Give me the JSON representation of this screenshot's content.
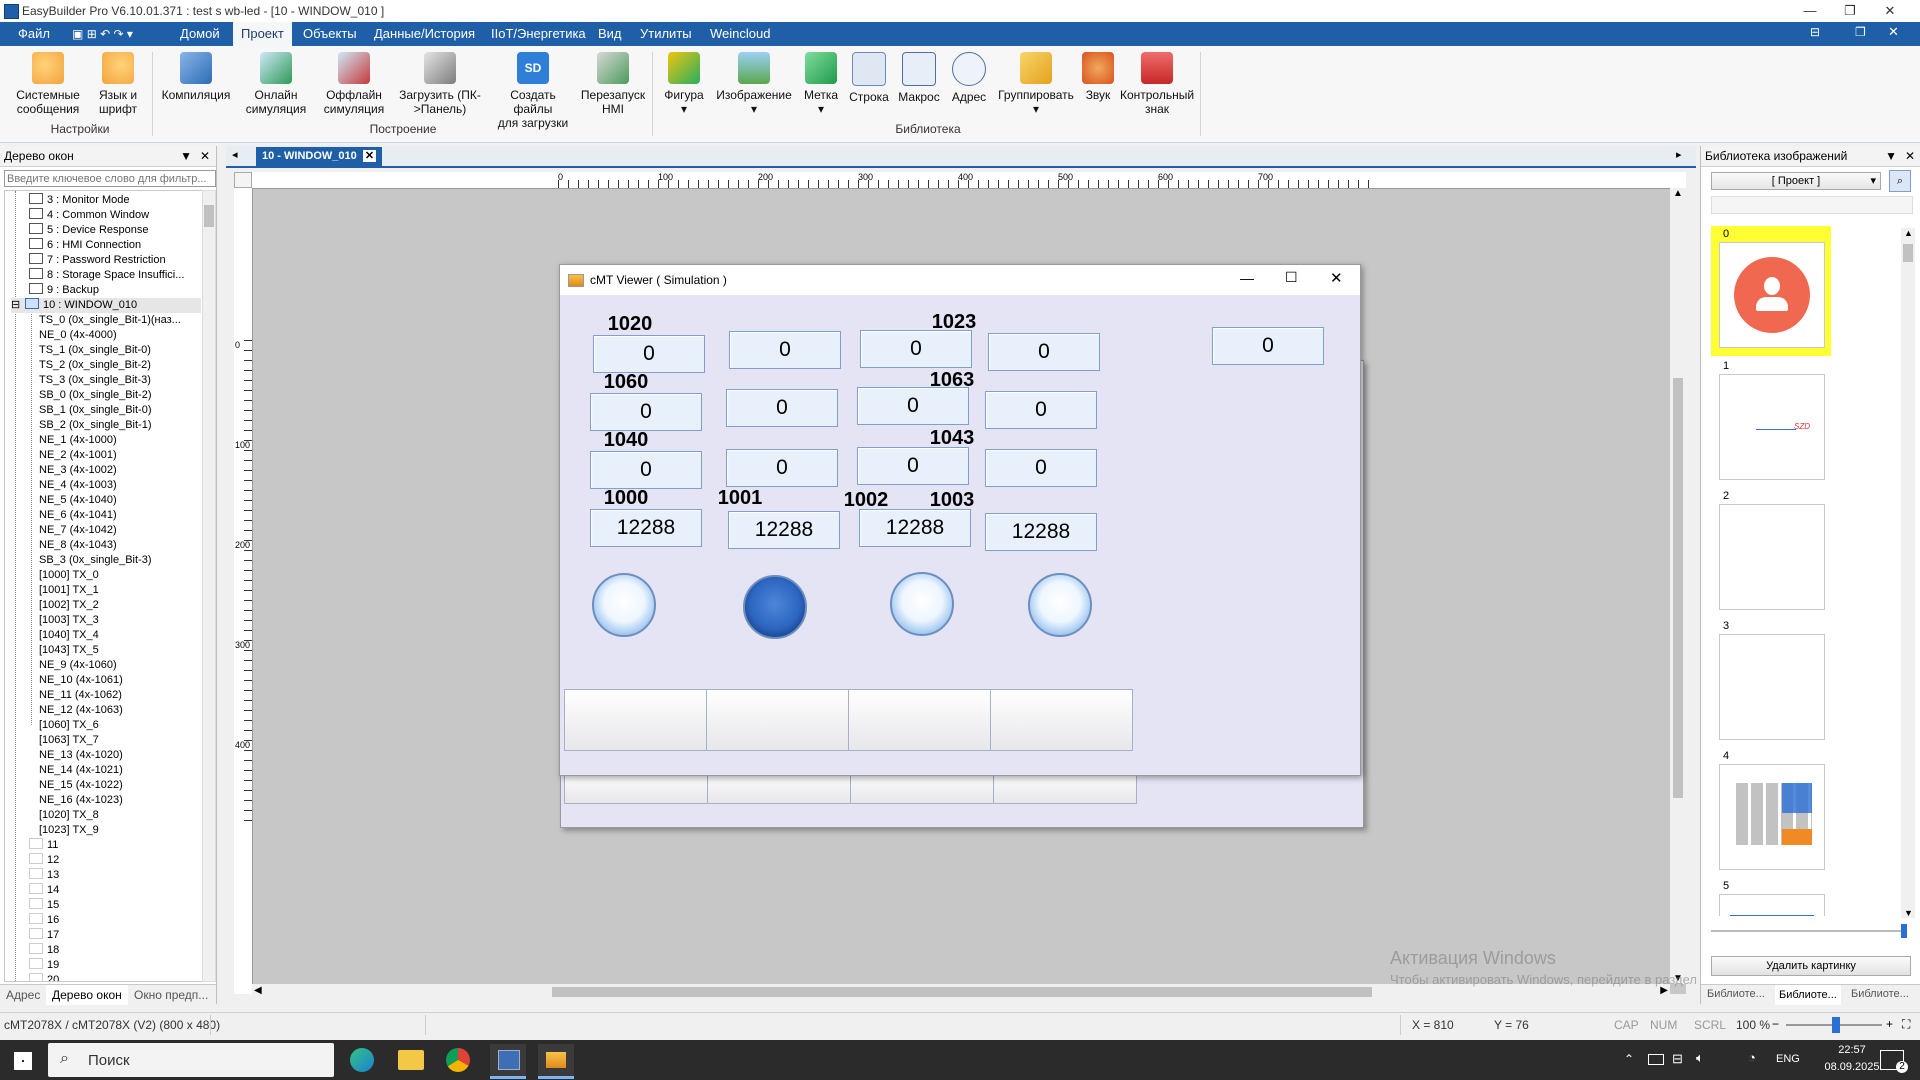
{
  "window": {
    "title": "EasyBuilder Pro V6.10.01.371 : test s wb-led - [10 - WINDOW_010 ]",
    "min": "—",
    "restore": "❐",
    "close": "✕"
  },
  "menu": {
    "items": [
      "Файл",
      "Домой",
      "Проект",
      "Объекты",
      "Данные/История",
      "IIoT/Энергетика",
      "Вид",
      "Утилиты",
      "Weincloud"
    ],
    "active": "Проект"
  },
  "ribbon": {
    "buttons": [
      {
        "label1": "Системные",
        "label2": "сообщения",
        "icon": "system-messages-icon"
      },
      {
        "label1": "Язык и",
        "label2": "шрифт",
        "icon": "language-font-icon"
      },
      {
        "label1": "Компиляция",
        "label2": "",
        "icon": "compile-icon"
      },
      {
        "label1": "Онлайн",
        "label2": "симуляция",
        "icon": "online-simulation-icon"
      },
      {
        "label1": "Оффлайн",
        "label2": "симуляция",
        "icon": "offline-simulation-icon"
      },
      {
        "label1": "Загрузить (ПК-",
        "label2": ">Панель)",
        "icon": "download-icon"
      },
      {
        "label1": "Создать файлы",
        "label2": "для загрузки",
        "icon": "sd-card-icon"
      },
      {
        "label1": "Перезапуск",
        "label2": "HMI",
        "icon": "restart-hmi-icon"
      },
      {
        "label1": "Фигура",
        "label2": "▾",
        "icon": "shape-icon"
      },
      {
        "label1": "Изображение",
        "label2": "▾",
        "icon": "picture-icon"
      },
      {
        "label1": "Метка",
        "label2": "▾",
        "icon": "tag-icon"
      },
      {
        "label1": "Строка",
        "label2": "",
        "icon": "string-icon"
      },
      {
        "label1": "Макрос",
        "label2": "",
        "icon": "macro-icon"
      },
      {
        "label1": "Адрес",
        "label2": "",
        "icon": "address-icon"
      },
      {
        "label1": "Группировать",
        "label2": "▾",
        "icon": "group-icon"
      },
      {
        "label1": "Звук",
        "label2": "",
        "icon": "sound-icon"
      },
      {
        "label1": "Контрольный",
        "label2": "знак",
        "icon": "lock-icon"
      }
    ],
    "groups": [
      "Настройки",
      "Построение",
      "Библиотека"
    ]
  },
  "left_panel": {
    "title": "Дерево окон",
    "search_placeholder": "Введите ключевое слово для фильтр...",
    "items": [
      "3 : Monitor Mode",
      "4 : Common Window",
      "5 : Device Response",
      "6 : HMI Connection",
      "7 : Password Restriction",
      "8 : Storage Space Insuffici...",
      "9 : Backup",
      "10 : WINDOW_010",
      "TS_0 (0x_single_Bit-1)(наз...",
      "NE_0 (4x-4000)",
      "TS_1 (0x_single_Bit-0)",
      "TS_2 (0x_single_Bit-2)",
      "TS_3 (0x_single_Bit-3)",
      "SB_0 (0x_single_Bit-2)",
      "SB_1 (0x_single_Bit-0)",
      "SB_2 (0x_single_Bit-1)",
      "NE_1 (4x-1000)",
      "NE_2 (4x-1001)",
      "NE_3 (4x-1002)",
      "NE_4 (4x-1003)",
      "NE_5 (4x-1040)",
      "NE_6 (4x-1041)",
      "NE_7 (4x-1042)",
      "NE_8 (4x-1043)",
      "SB_3 (0x_single_Bit-3)",
      "[1000] TX_0",
      "[1001] TX_1",
      "[1002] TX_2",
      "[1003] TX_3",
      "[1040] TX_4",
      "[1043] TX_5",
      "NE_9 (4x-1060)",
      "NE_10 (4x-1061)",
      "NE_11 (4x-1062)",
      "NE_12 (4x-1063)",
      "[1060] TX_6",
      "[1063] TX_7",
      "NE_13 (4x-1020)",
      "NE_14 (4x-1021)",
      "NE_15 (4x-1022)",
      "NE_16 (4x-1023)",
      "[1020] TX_8",
      "[1023] TX_9",
      "11",
      "12",
      "13",
      "14",
      "15",
      "16",
      "17",
      "18",
      "19",
      "20"
    ],
    "tabs": [
      "Адрес",
      "Дерево окон",
      "Окно предп..."
    ]
  },
  "doc_tab": {
    "label": "10 - WINDOW_010"
  },
  "rulers": {
    "top": [
      "0",
      "100",
      "200",
      "300",
      "400",
      "500",
      "600",
      "700"
    ],
    "left": [
      "0",
      "100",
      "200",
      "300",
      "400"
    ]
  },
  "viewer": {
    "title": "cMT Viewer ( Simulation )",
    "labels": [
      "1020",
      "1023",
      "1060",
      "1063",
      "1040",
      "1043",
      "1000",
      "1001",
      "1002",
      "1003"
    ],
    "values": {
      "r1": [
        "0",
        "0",
        "0",
        "0"
      ],
      "r2": [
        "0",
        "0",
        "0",
        "0"
      ],
      "r3": [
        "0",
        "0",
        "0",
        "0"
      ],
      "r4": [
        "12288",
        "12288",
        "12288",
        "12288"
      ],
      "extra": "0"
    },
    "lamps": [
      "off",
      "on",
      "off",
      "off"
    ]
  },
  "right_panel": {
    "title": "Библиотека изображений",
    "project_select": "[ Проект ]",
    "thumbs": [
      "0",
      "1",
      "2",
      "3",
      "4",
      "5"
    ],
    "thumb1_text": "SZD",
    "delete_button": "Удалить картинку",
    "tabs": [
      "Библиоте...",
      "Библиоте...",
      "Библиоте..."
    ]
  },
  "watermark": {
    "line1": "Активация Windows",
    "line2": "Чтобы активировать Windows, перейдите в раздел \"Параметры\"."
  },
  "status": {
    "model": "cMT2078X / cMT2078X (V2) (800 x 480)",
    "x": "X = 810",
    "y": "Y = 76",
    "cap": "CAP",
    "num": "NUM",
    "scrl": "SCRL",
    "zoom": "100 %"
  },
  "taskbar": {
    "search": "Поиск",
    "time": "22:57",
    "date": "08.09.2025",
    "lang": "ENG",
    "notifications": "2"
  },
  "colors": {
    "menubar": "#1f5fa8",
    "highlight": "#ffff33",
    "avatar": "#f0684f"
  }
}
